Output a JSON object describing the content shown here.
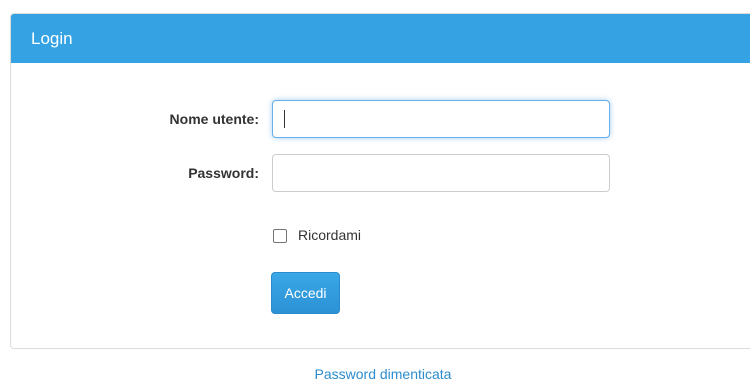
{
  "panel": {
    "title": "Login"
  },
  "form": {
    "username_label": "Nome utente:",
    "username_value": "",
    "password_label": "Password:",
    "password_value": "",
    "remember_label": "Ricordami",
    "remember_checked": false,
    "submit_label": "Accedi"
  },
  "footer": {
    "forgot_password_link": "Password dimenticata"
  },
  "colors": {
    "header_background": "#35a3e3",
    "button_background": "#2b92d6",
    "link_color": "#2d8ccd"
  }
}
